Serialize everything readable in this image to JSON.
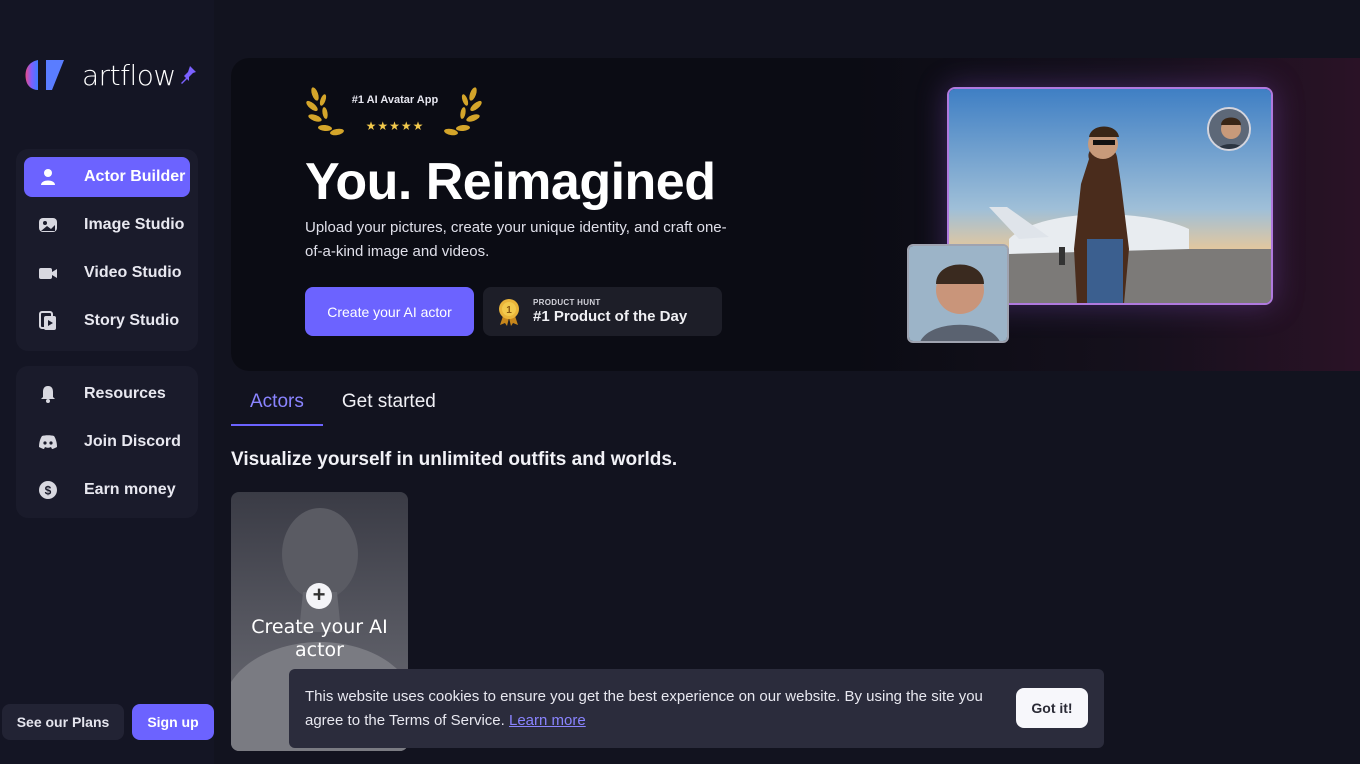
{
  "brand": {
    "name": "artflow"
  },
  "sidebar": {
    "primary": [
      {
        "label": "Actor Builder",
        "icon": "user-icon",
        "active": true
      },
      {
        "label": "Image Studio",
        "icon": "image-icon",
        "active": false
      },
      {
        "label": "Video Studio",
        "icon": "video-camera-icon",
        "active": false
      },
      {
        "label": "Story Studio",
        "icon": "story-play-icon",
        "active": false
      }
    ],
    "secondary": [
      {
        "label": "Resources",
        "icon": "bell-icon"
      },
      {
        "label": "Join Discord",
        "icon": "discord-icon"
      },
      {
        "label": "Earn money",
        "icon": "dollar-icon"
      }
    ],
    "plans_label": "See our Plans",
    "signup_label": "Sign up"
  },
  "hero": {
    "award_label": "#1 AI Avatar App",
    "stars": "★★★★★",
    "title": "You. Reimagined",
    "subtitle": "Upload your pictures, create your unique identity, and craft one-of-a-kind image and videos.",
    "cta_label": "Create your AI actor",
    "product_hunt_small": "PRODUCT HUNT",
    "product_hunt_big": "#1 Product of the Day"
  },
  "tabs": [
    {
      "label": "Actors",
      "active": true
    },
    {
      "label": "Get started",
      "active": false
    }
  ],
  "section_title": "Visualize yourself in unlimited outfits and worlds.",
  "actor_card": {
    "label": "Create your AI actor"
  },
  "cookie": {
    "text": "This website uses cookies to ensure you get the best experience on our website. By using the site you agree to the Terms of Service.",
    "link": "Learn more",
    "button": "Got it!"
  },
  "colors": {
    "accent": "#6c63ff",
    "background": "#12131f",
    "panel": "#1a1b2b",
    "gold": "#f2c94c"
  }
}
